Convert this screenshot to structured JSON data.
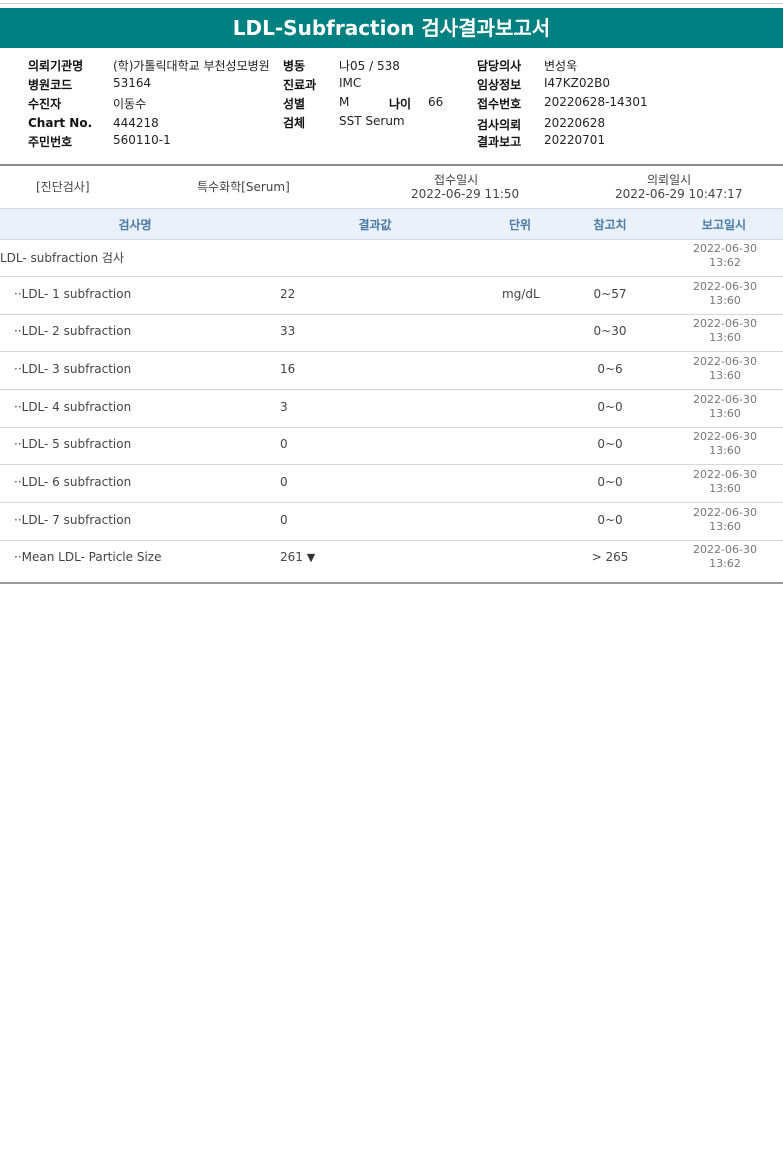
{
  "title": "LDL-Subfraction 검사결과보고서",
  "header": {
    "institution_label": "의뢰기관명",
    "institution": "(학)가톨릭대학교 부천성모병원",
    "ward_label": "병동",
    "ward": "나05 / 538",
    "doctor_label": "담당의사",
    "doctor": "변성욱",
    "hospcode_label": "병원코드",
    "hospcode": "53164",
    "dept_label": "진료과",
    "dept": "IMC",
    "clinical_label": "임상정보",
    "clinical": "I47KZ02B0",
    "patient_label": "수진자",
    "patient": "이동수",
    "sex_label": "성별",
    "sex": "M",
    "age_label": "나이",
    "age": "66",
    "accession_label": "접수번호",
    "accession": "20220628-14301",
    "chart_label": "Chart No.",
    "chart": "444218",
    "specimen_label": "검체",
    "specimen": "SST Serum",
    "requestdate_label": "검사의뢰",
    "requestdate": "20220628",
    "ssn_label": "주민번호",
    "ssn": "560110-1",
    "reportdate_label": "결과보고",
    "reportdate": "20220701"
  },
  "receipt": {
    "category": "[진단검사]",
    "section": "특수화학[Serum]",
    "received_label": "접수일시",
    "received": "2022-06-29  11:50",
    "requested_label": "의뢰일시",
    "requested": "2022-06-29  10:47:17"
  },
  "table": {
    "headers": [
      "검사명",
      "결과값",
      "단위",
      "참고치",
      "보고일시"
    ],
    "rows": [
      {
        "name": "LDL- subfraction 검사",
        "result": "",
        "flag": "",
        "unit": "",
        "ref": "",
        "date": "2022-06-30",
        "time": "13:62"
      },
      {
        "name": "··LDL- 1 subfraction",
        "result": "22",
        "flag": "",
        "unit": "mg/dL",
        "ref": "0~57",
        "date": "2022-06-30",
        "time": "13:60"
      },
      {
        "name": "··LDL- 2 subfraction",
        "result": "33",
        "flag": "",
        "unit": "",
        "ref": "0~30",
        "date": "2022-06-30",
        "time": "13:60"
      },
      {
        "name": "··LDL- 3 subfraction",
        "result": "16",
        "flag": "",
        "unit": "",
        "ref": "0~6",
        "date": "2022-06-30",
        "time": "13:60"
      },
      {
        "name": "··LDL- 4 subfraction",
        "result": "3",
        "flag": "",
        "unit": "",
        "ref": "0~0",
        "date": "2022-06-30",
        "time": "13:60"
      },
      {
        "name": "··LDL- 5 subfraction",
        "result": "0",
        "flag": "",
        "unit": "",
        "ref": "0~0",
        "date": "2022-06-30",
        "time": "13:60"
      },
      {
        "name": "··LDL- 6 subfraction",
        "result": "0",
        "flag": "",
        "unit": "",
        "ref": "0~0",
        "date": "2022-06-30",
        "time": "13:60"
      },
      {
        "name": "··LDL- 7 subfraction",
        "result": "0",
        "flag": "",
        "unit": "",
        "ref": "0~0",
        "date": "2022-06-30",
        "time": "13:60"
      },
      {
        "name": "··Mean LDL- Particle Size",
        "result": "261",
        "flag": "▼",
        "unit": "",
        "ref": "> 265",
        "date": "2022-06-30",
        "time": "13:62"
      }
    ]
  },
  "colors": {
    "title_bg": "#008080",
    "header_text": "#4a7aa8",
    "table_header_bg": "#e9f0f7"
  }
}
